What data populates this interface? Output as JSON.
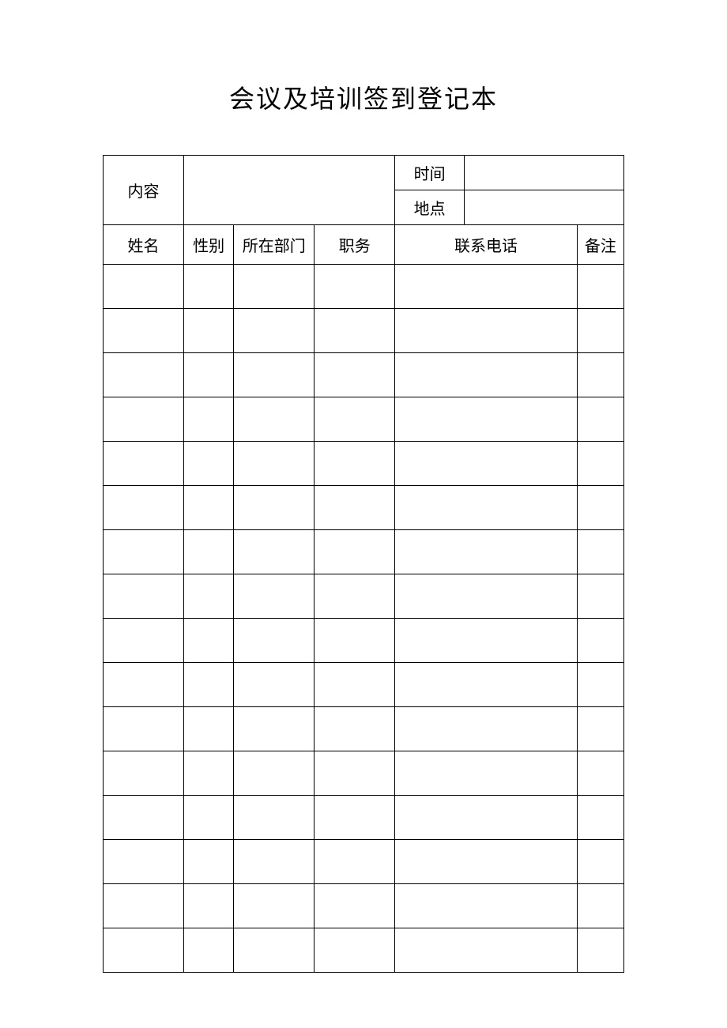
{
  "title": "会议及培训签到登记本",
  "header": {
    "content_label": "内容",
    "time_label": "时间",
    "location_label": "地点",
    "content_value": "",
    "time_value": "",
    "location_value": ""
  },
  "columns": {
    "name": "姓名",
    "gender": "性别",
    "department": "所在部门",
    "position": "职务",
    "phone": "联系电话",
    "remark": "备注"
  },
  "rows": [
    {
      "name": "",
      "gender": "",
      "department": "",
      "position": "",
      "phone": "",
      "remark": ""
    },
    {
      "name": "",
      "gender": "",
      "department": "",
      "position": "",
      "phone": "",
      "remark": ""
    },
    {
      "name": "",
      "gender": "",
      "department": "",
      "position": "",
      "phone": "",
      "remark": ""
    },
    {
      "name": "",
      "gender": "",
      "department": "",
      "position": "",
      "phone": "",
      "remark": ""
    },
    {
      "name": "",
      "gender": "",
      "department": "",
      "position": "",
      "phone": "",
      "remark": ""
    },
    {
      "name": "",
      "gender": "",
      "department": "",
      "position": "",
      "phone": "",
      "remark": ""
    },
    {
      "name": "",
      "gender": "",
      "department": "",
      "position": "",
      "phone": "",
      "remark": ""
    },
    {
      "name": "",
      "gender": "",
      "department": "",
      "position": "",
      "phone": "",
      "remark": ""
    },
    {
      "name": "",
      "gender": "",
      "department": "",
      "position": "",
      "phone": "",
      "remark": ""
    },
    {
      "name": "",
      "gender": "",
      "department": "",
      "position": "",
      "phone": "",
      "remark": ""
    },
    {
      "name": "",
      "gender": "",
      "department": "",
      "position": "",
      "phone": "",
      "remark": ""
    },
    {
      "name": "",
      "gender": "",
      "department": "",
      "position": "",
      "phone": "",
      "remark": ""
    },
    {
      "name": "",
      "gender": "",
      "department": "",
      "position": "",
      "phone": "",
      "remark": ""
    },
    {
      "name": "",
      "gender": "",
      "department": "",
      "position": "",
      "phone": "",
      "remark": ""
    },
    {
      "name": "",
      "gender": "",
      "department": "",
      "position": "",
      "phone": "",
      "remark": ""
    },
    {
      "name": "",
      "gender": "",
      "department": "",
      "position": "",
      "phone": "",
      "remark": ""
    }
  ]
}
